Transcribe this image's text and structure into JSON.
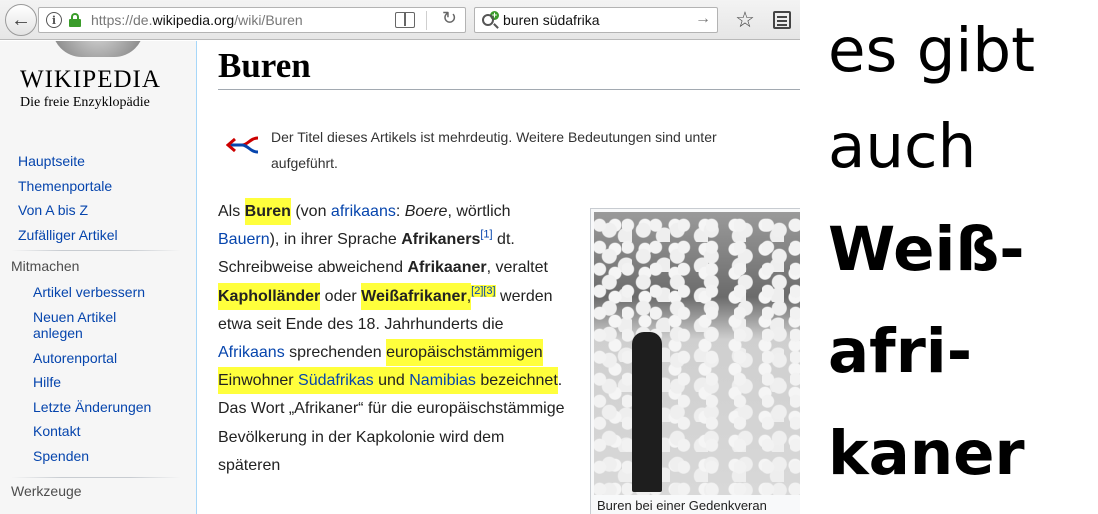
{
  "browser": {
    "url_prefix": "https://de.",
    "url_domain": "wikipedia.org",
    "url_path": "/wiki/Buren",
    "search_query": "buren südafrika",
    "back_icon": "back-arrow-icon",
    "reload_icon": "reload-icon",
    "star_icon": "star-icon"
  },
  "logo": {
    "wordmark": "WIKIPEDIA",
    "tagline": "Die freie Enzyklopädie"
  },
  "sidebar": {
    "main_links": [
      "Hauptseite",
      "Themenportale",
      "Von A bis Z",
      "Zufälliger Artikel"
    ],
    "mitmachen": {
      "heading": "Mitmachen",
      "links": [
        "Artikel verbessern",
        "Neuen Artikel anlegen",
        "Autorenportal",
        "Hilfe",
        "Letzte Änderungen",
        "Kontakt",
        "Spenden"
      ]
    },
    "werkzeuge": {
      "heading": "Werkzeuge"
    }
  },
  "article": {
    "title": "Buren",
    "hatnote": "Der Titel dieses Artikels ist mehrdeutig. Weitere Bedeutungen sind unter aufgeführt.",
    "hatnote_line1": "Der Titel dieses Artikels ist mehrdeutig. Weitere Bedeutungen sind unter",
    "hatnote_line2": "aufgeführt.",
    "body": {
      "t01": "Als ",
      "t02": "Buren",
      "t03": " (von ",
      "t04": "afrikaans",
      "t05": ": ",
      "t06": "Boere",
      "t07": ", wörtlich ",
      "t08": "Bauern",
      "t09": "), in ihrer Sprache ",
      "t10": "Afrikaners",
      "t11": "[1]",
      "t12": " dt. Schreibweise abweichend ",
      "t13": "Afrikaaner",
      "t14": ", veraltet ",
      "t15": "Kapholländer",
      "t16": " oder ",
      "t17": "Weißafrikaner",
      "t18": ",",
      "t19": "[2][3]",
      "t20": " werden etwa seit Ende des 18. Jahrhunderts die ",
      "t21": "Afrikaans",
      "t22": " sprechenden ",
      "t23": "europäischstämmige",
      "t24": "n Einwohner ",
      "t25": "Südafrikas",
      "t26": " und ",
      "t27": "Namibias",
      "t28": " bezeichnet",
      "t29": ". Das Wort „Afrikaner“ für die europäischstämmige Bevölkerung in der Kapkolonie wird dem späteren"
    },
    "image_caption": "Buren bei einer Gedenkveran"
  },
  "annotation": {
    "line1": "es gibt",
    "line2": "auch",
    "line3": "Weiß-",
    "line4": "afri-",
    "line5": "kaner"
  }
}
